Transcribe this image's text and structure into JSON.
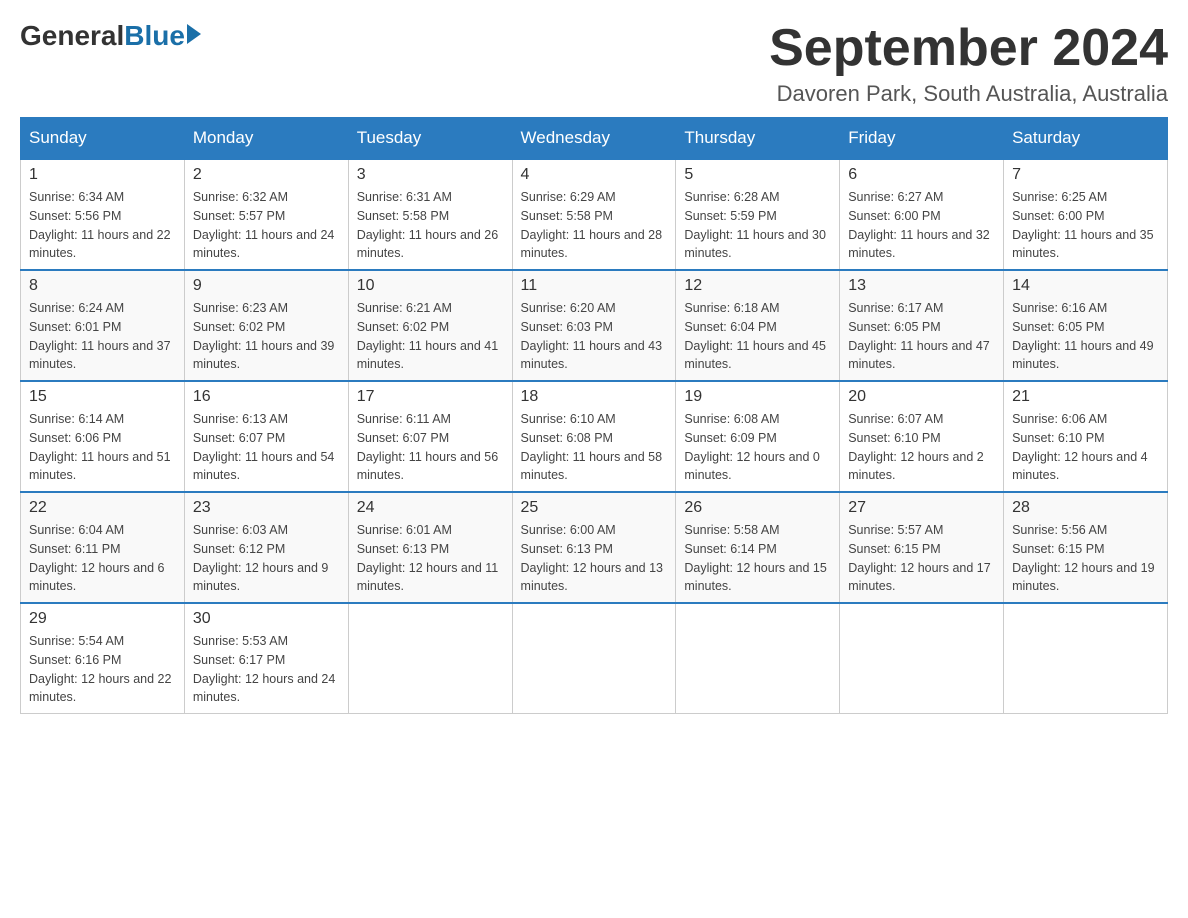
{
  "header": {
    "logo": {
      "general": "General",
      "blue": "Blue"
    },
    "title": "September 2024",
    "location": "Davoren Park, South Australia, Australia"
  },
  "days_of_week": [
    "Sunday",
    "Monday",
    "Tuesday",
    "Wednesday",
    "Thursday",
    "Friday",
    "Saturday"
  ],
  "weeks": [
    [
      {
        "date": "1",
        "sunrise": "6:34 AM",
        "sunset": "5:56 PM",
        "daylight": "11 hours and 22 minutes."
      },
      {
        "date": "2",
        "sunrise": "6:32 AM",
        "sunset": "5:57 PM",
        "daylight": "11 hours and 24 minutes."
      },
      {
        "date": "3",
        "sunrise": "6:31 AM",
        "sunset": "5:58 PM",
        "daylight": "11 hours and 26 minutes."
      },
      {
        "date": "4",
        "sunrise": "6:29 AM",
        "sunset": "5:58 PM",
        "daylight": "11 hours and 28 minutes."
      },
      {
        "date": "5",
        "sunrise": "6:28 AM",
        "sunset": "5:59 PM",
        "daylight": "11 hours and 30 minutes."
      },
      {
        "date": "6",
        "sunrise": "6:27 AM",
        "sunset": "6:00 PM",
        "daylight": "11 hours and 32 minutes."
      },
      {
        "date": "7",
        "sunrise": "6:25 AM",
        "sunset": "6:00 PM",
        "daylight": "11 hours and 35 minutes."
      }
    ],
    [
      {
        "date": "8",
        "sunrise": "6:24 AM",
        "sunset": "6:01 PM",
        "daylight": "11 hours and 37 minutes."
      },
      {
        "date": "9",
        "sunrise": "6:23 AM",
        "sunset": "6:02 PM",
        "daylight": "11 hours and 39 minutes."
      },
      {
        "date": "10",
        "sunrise": "6:21 AM",
        "sunset": "6:02 PM",
        "daylight": "11 hours and 41 minutes."
      },
      {
        "date": "11",
        "sunrise": "6:20 AM",
        "sunset": "6:03 PM",
        "daylight": "11 hours and 43 minutes."
      },
      {
        "date": "12",
        "sunrise": "6:18 AM",
        "sunset": "6:04 PM",
        "daylight": "11 hours and 45 minutes."
      },
      {
        "date": "13",
        "sunrise": "6:17 AM",
        "sunset": "6:05 PM",
        "daylight": "11 hours and 47 minutes."
      },
      {
        "date": "14",
        "sunrise": "6:16 AM",
        "sunset": "6:05 PM",
        "daylight": "11 hours and 49 minutes."
      }
    ],
    [
      {
        "date": "15",
        "sunrise": "6:14 AM",
        "sunset": "6:06 PM",
        "daylight": "11 hours and 51 minutes."
      },
      {
        "date": "16",
        "sunrise": "6:13 AM",
        "sunset": "6:07 PM",
        "daylight": "11 hours and 54 minutes."
      },
      {
        "date": "17",
        "sunrise": "6:11 AM",
        "sunset": "6:07 PM",
        "daylight": "11 hours and 56 minutes."
      },
      {
        "date": "18",
        "sunrise": "6:10 AM",
        "sunset": "6:08 PM",
        "daylight": "11 hours and 58 minutes."
      },
      {
        "date": "19",
        "sunrise": "6:08 AM",
        "sunset": "6:09 PM",
        "daylight": "12 hours and 0 minutes."
      },
      {
        "date": "20",
        "sunrise": "6:07 AM",
        "sunset": "6:10 PM",
        "daylight": "12 hours and 2 minutes."
      },
      {
        "date": "21",
        "sunrise": "6:06 AM",
        "sunset": "6:10 PM",
        "daylight": "12 hours and 4 minutes."
      }
    ],
    [
      {
        "date": "22",
        "sunrise": "6:04 AM",
        "sunset": "6:11 PM",
        "daylight": "12 hours and 6 minutes."
      },
      {
        "date": "23",
        "sunrise": "6:03 AM",
        "sunset": "6:12 PM",
        "daylight": "12 hours and 9 minutes."
      },
      {
        "date": "24",
        "sunrise": "6:01 AM",
        "sunset": "6:13 PM",
        "daylight": "12 hours and 11 minutes."
      },
      {
        "date": "25",
        "sunrise": "6:00 AM",
        "sunset": "6:13 PM",
        "daylight": "12 hours and 13 minutes."
      },
      {
        "date": "26",
        "sunrise": "5:58 AM",
        "sunset": "6:14 PM",
        "daylight": "12 hours and 15 minutes."
      },
      {
        "date": "27",
        "sunrise": "5:57 AM",
        "sunset": "6:15 PM",
        "daylight": "12 hours and 17 minutes."
      },
      {
        "date": "28",
        "sunrise": "5:56 AM",
        "sunset": "6:15 PM",
        "daylight": "12 hours and 19 minutes."
      }
    ],
    [
      {
        "date": "29",
        "sunrise": "5:54 AM",
        "sunset": "6:16 PM",
        "daylight": "12 hours and 22 minutes."
      },
      {
        "date": "30",
        "sunrise": "5:53 AM",
        "sunset": "6:17 PM",
        "daylight": "12 hours and 24 minutes."
      },
      null,
      null,
      null,
      null,
      null
    ]
  ]
}
